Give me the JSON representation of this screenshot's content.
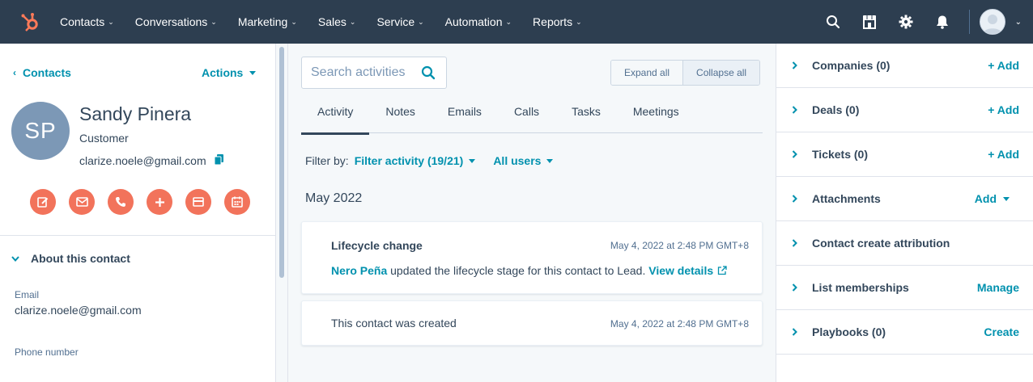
{
  "nav": {
    "items": [
      {
        "label": "Contacts"
      },
      {
        "label": "Conversations"
      },
      {
        "label": "Marketing"
      },
      {
        "label": "Sales"
      },
      {
        "label": "Service"
      },
      {
        "label": "Automation"
      },
      {
        "label": "Reports"
      }
    ],
    "brand_color": "#ff7a59",
    "bg_color": "#2d3e50"
  },
  "left": {
    "back_label": "Contacts",
    "actions_label": "Actions",
    "initials": "SP",
    "name": "Sandy Pinera",
    "stage": "Customer",
    "email": "clarize.noele@gmail.com",
    "action_icons": [
      "note-icon",
      "email-icon",
      "call-icon",
      "plus-icon",
      "log-activity-icon",
      "meeting-icon"
    ],
    "about_label": "About this contact",
    "fields": [
      {
        "label": "Email",
        "value": "clarize.noele@gmail.com"
      },
      {
        "label": "Phone number",
        "value": ""
      }
    ]
  },
  "middle": {
    "search_placeholder": "Search activities",
    "expand_all": "Expand all",
    "collapse_all": "Collapse all",
    "tabs": [
      {
        "label": "Activity"
      },
      {
        "label": "Notes"
      },
      {
        "label": "Emails"
      },
      {
        "label": "Calls"
      },
      {
        "label": "Tasks"
      },
      {
        "label": "Meetings"
      }
    ],
    "filter_by": "Filter by:",
    "filter_activity": "Filter activity (19/21)",
    "all_users": "All users",
    "month": "May 2022",
    "cards": [
      {
        "title": "Lifecycle change",
        "timestamp": "May 4, 2022 at 2:48 PM GMT+8",
        "actor": "Nero Peña",
        "body": " updated the lifecycle stage for this contact to Lead. ",
        "link": "View details"
      },
      {
        "title": "This contact was created",
        "timestamp": "May 4, 2022 at 2:48 PM GMT+8"
      }
    ]
  },
  "right": {
    "rows": [
      {
        "name": "Companies (0)",
        "action": "+ Add"
      },
      {
        "name": "Deals (0)",
        "action": "+ Add"
      },
      {
        "name": "Tickets (0)",
        "action": "+ Add"
      },
      {
        "name": "Attachments",
        "action": "Add"
      },
      {
        "name": "Contact create attribution",
        "action": ""
      },
      {
        "name": "List memberships",
        "action": "Manage"
      },
      {
        "name": "Playbooks (0)",
        "action": "Create"
      }
    ]
  },
  "colors": {
    "accent": "#0091ae",
    "action_button": "#f2735b",
    "avatar": "#7c98b6"
  }
}
